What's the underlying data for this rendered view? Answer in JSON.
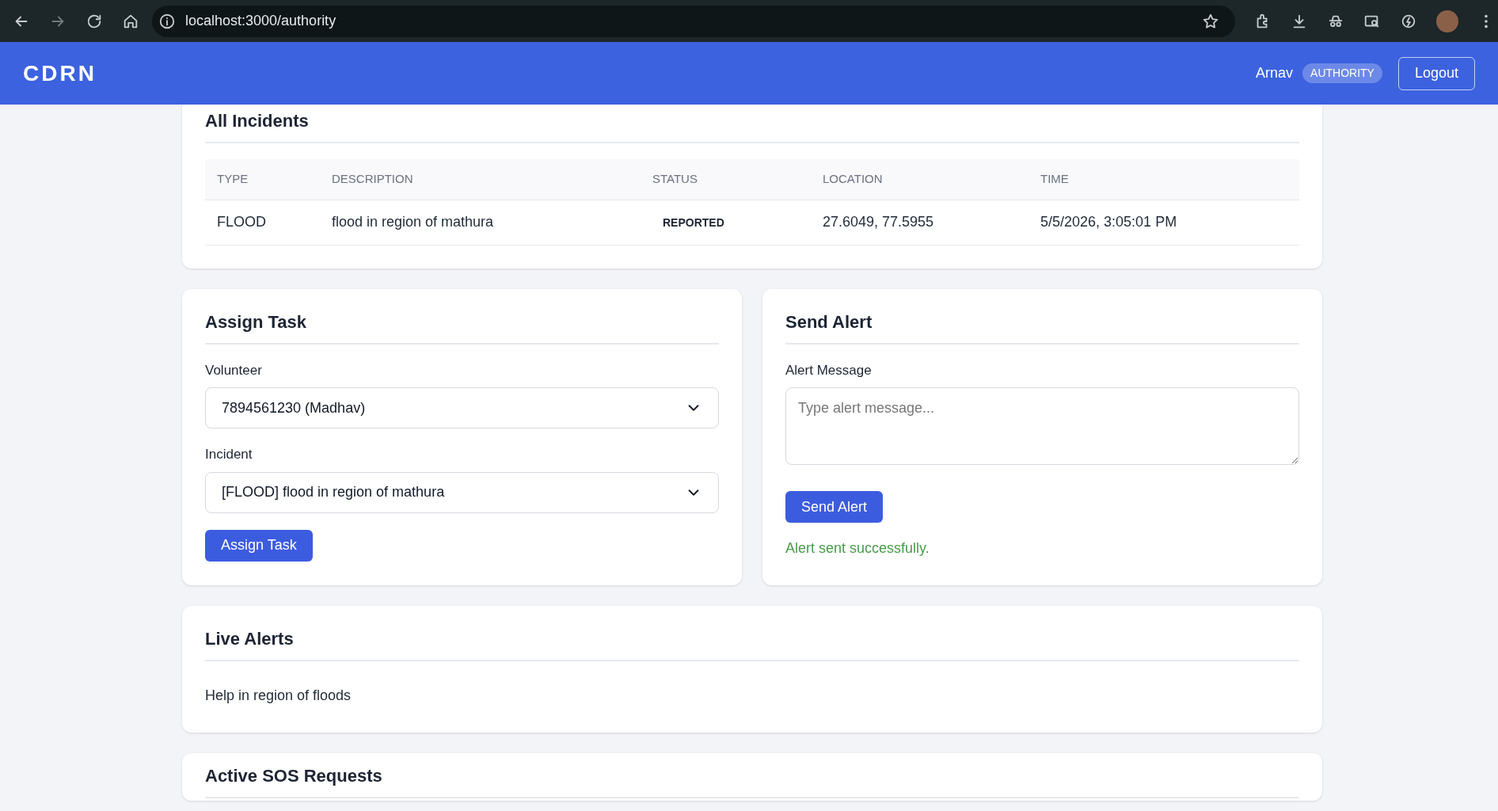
{
  "browser": {
    "url": "localhost:3000/authority"
  },
  "header": {
    "logo": "CDRN",
    "user": "Arnav",
    "role": "AUTHORITY",
    "logout": "Logout"
  },
  "incidents": {
    "title": "All Incidents",
    "columns": [
      "TYPE",
      "DESCRIPTION",
      "STATUS",
      "LOCATION",
      "TIME"
    ],
    "rows": [
      [
        "FLOOD",
        "flood in region of mathura",
        "REPORTED",
        "27.6049, 77.5955",
        "5/5/2026, 3:05:01 PM"
      ]
    ]
  },
  "assign_task": {
    "title": "Assign Task",
    "fields": [
      {
        "label": "Volunteer",
        "value": "7894561230 (Madhav)"
      },
      {
        "label": "Incident",
        "value": "[FLOOD] flood in region of mathura"
      }
    ],
    "button": "Assign Task"
  },
  "send_alert": {
    "title": "Send Alert",
    "label": "Alert Message",
    "placeholder": "Type alert message...",
    "button": "Send Alert",
    "status": "Alert sent successfully."
  },
  "live_alerts": {
    "title": "Live Alerts",
    "items": [
      "Help in region of floods"
    ]
  },
  "sos": {
    "title": "Active SOS Requests"
  }
}
